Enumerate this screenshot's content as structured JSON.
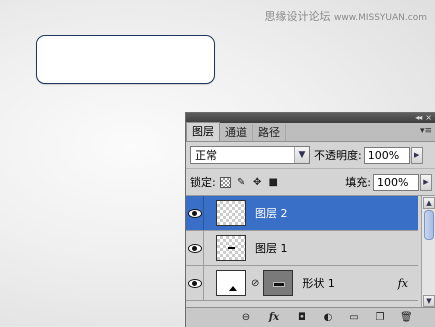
{
  "watermark": {
    "site": "思缘设计论坛",
    "url": "www.MISSYUAN.com"
  },
  "panel": {
    "title_buttons": {
      "collapse": "◂◂",
      "close": "×"
    },
    "tabs": [
      {
        "label": "图层",
        "active": true
      },
      {
        "label": "通道",
        "active": false
      },
      {
        "label": "路径",
        "active": false
      }
    ],
    "menu_icon": "panel-menu-icon",
    "blend_mode": "正常",
    "opacity_label": "不透明度:",
    "opacity_value": "100%",
    "lock_label": "锁定:",
    "fill_label": "填充:",
    "fill_value": "100%",
    "layers": [
      {
        "name": "图层 2",
        "selected": true,
        "visible": true
      },
      {
        "name": "图层 1",
        "selected": false,
        "visible": true
      },
      {
        "name": "形状 1",
        "selected": false,
        "visible": true,
        "has_mask": true,
        "has_fx": true,
        "fx_label": "fx"
      }
    ],
    "bottom_fx": "fx"
  },
  "colors": {
    "selection": "#3a6fc8",
    "shape_border": "#1f3560"
  }
}
